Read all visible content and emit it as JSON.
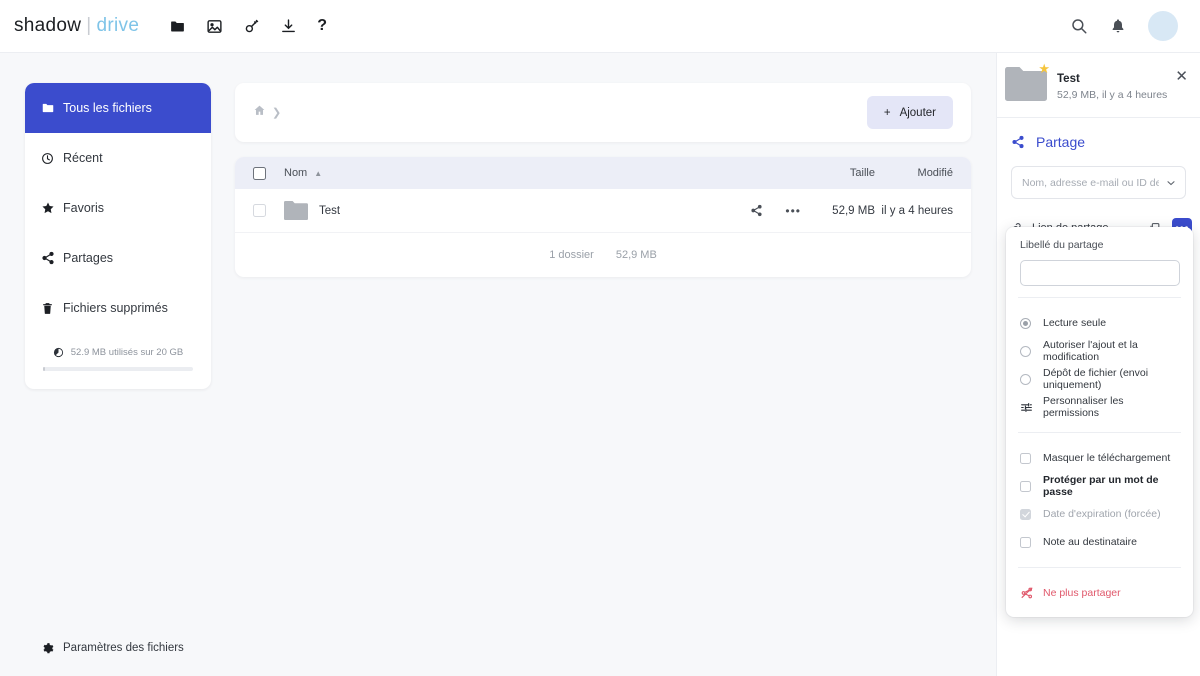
{
  "topbar": {
    "logo_shadow": "shadow",
    "logo_sep": "|",
    "logo_drive": "drive",
    "nav": [
      {
        "name": "folder-icon",
        "label": "Fichiers"
      },
      {
        "name": "image-icon",
        "label": "Images"
      },
      {
        "name": "key-icon",
        "label": "Cles"
      },
      {
        "name": "download-icon",
        "label": "Telechargements"
      },
      {
        "name": "help-icon",
        "label": "?"
      }
    ],
    "help_glyph": "?",
    "search_label": "Rechercher",
    "bell_label": "Notifications",
    "avatar_label": "Compte"
  },
  "sidebar": {
    "items": [
      {
        "label": "Tous les fichiers",
        "icon": "folder-icon",
        "active": true
      },
      {
        "label": "Récent",
        "icon": "clock-icon",
        "active": false
      },
      {
        "label": "Favoris",
        "icon": "star-icon",
        "active": false
      },
      {
        "label": "Partages",
        "icon": "share-icon",
        "active": false
      },
      {
        "label": "Fichiers supprimés",
        "icon": "trash-icon",
        "active": false
      }
    ],
    "storage_text": "52.9 MB utilisés sur 20 GB",
    "settings_label": "Paramètres des fichiers"
  },
  "main": {
    "breadcrumb_home": "⌂",
    "breadcrumb_sep": "❯",
    "add_button": "Ajouter",
    "add_plus": "+",
    "columns": {
      "name": "Nom",
      "sort_arrow": "▲",
      "size": "Taille",
      "modified": "Modifié"
    },
    "rows": [
      {
        "name": "Test",
        "size": "52,9 MB",
        "modified": "il y a 4 heures",
        "type": "folder"
      }
    ],
    "footer_count": "1 dossier",
    "footer_size": "52,9 MB"
  },
  "details": {
    "file_name": "Test",
    "file_meta": "52,9 MB, il y a 4 heures",
    "close_glyph": "✕",
    "star_glyph": "★",
    "share_section_title": "Partage",
    "recipient_placeholder": "Nom, adresse e-mail ou ID de Clo",
    "recipient_value": "",
    "share_link_label": "Lien de partage",
    "copy_label": "Copier le lien",
    "more_glyph": "•••"
  },
  "dropdown": {
    "label_title": "Libellé du partage",
    "label_value": "",
    "options": [
      {
        "label": "Lecture seule",
        "selected": true
      },
      {
        "label": "Autoriser l'ajout et la modification",
        "selected": false
      },
      {
        "label": "Dépôt de fichier (envoi uniquement)",
        "selected": false
      }
    ],
    "customize": "Personnaliser les permissions",
    "checkboxes": [
      {
        "label": "Masquer le téléchargement",
        "checked": false,
        "bold": false,
        "muted": false
      },
      {
        "label": "Protéger par un mot de passe",
        "checked": false,
        "bold": true,
        "muted": false
      },
      {
        "label": "Date d'expiration (forcée)",
        "checked": true,
        "bold": false,
        "muted": true
      },
      {
        "label": "Note au destinataire",
        "checked": false,
        "bold": false,
        "muted": false
      }
    ],
    "unshare": "Ne plus partager"
  },
  "colors": {
    "accent_blue": "#3b4ccd",
    "logo_blue": "#7fc4e8",
    "danger_red": "#e0586b",
    "star_gold": "#f5c53d",
    "add_button_bg": "#e4e6f7"
  }
}
